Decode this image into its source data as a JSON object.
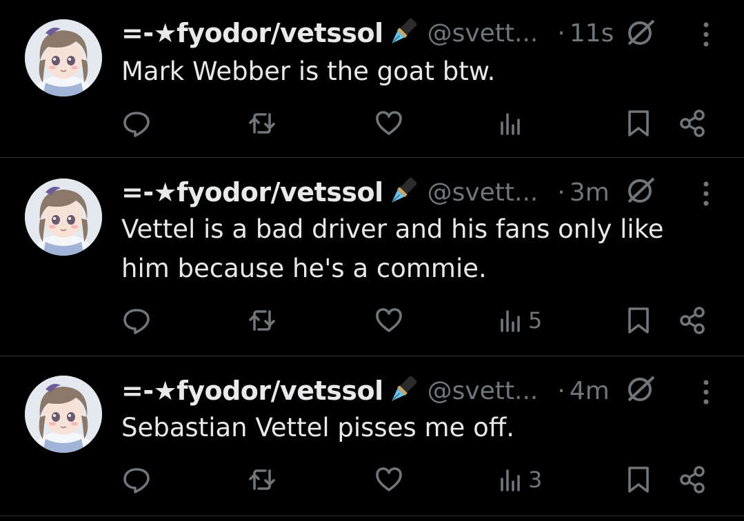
{
  "tweets": [
    {
      "display_name": "=-★fyodor/vetssol",
      "handle": "@svett...",
      "dot": "·",
      "time": "11s",
      "text": [
        "Mark Webber is the goat btw."
      ],
      "views": ""
    },
    {
      "display_name": "=-★fyodor/vetssol",
      "handle": "@svett...",
      "dot": "·",
      "time": "3m",
      "text": [
        "Vettel is a bad driver and his fans only like",
        "him because he's a commie."
      ],
      "views": "5"
    },
    {
      "display_name": "=-★fyodor/vetssol",
      "handle": "@svett...",
      "dot": "·",
      "time": "4m",
      "text": [
        "Sebastian Vettel pisses me off."
      ],
      "views": "3"
    }
  ],
  "icons": {
    "badge": "fountain-pen-emoji",
    "grok": "grok-icon",
    "more": "more-vertical-icon",
    "reply": "reply-icon",
    "repost": "repost-icon",
    "like": "heart-icon",
    "views": "views-icon",
    "bookmark": "bookmark-icon",
    "share": "share-icon"
  },
  "colors": {
    "background": "#000000",
    "text_primary": "#e7e9ea",
    "text_secondary": "#71767b",
    "divider": "#2f3336"
  }
}
